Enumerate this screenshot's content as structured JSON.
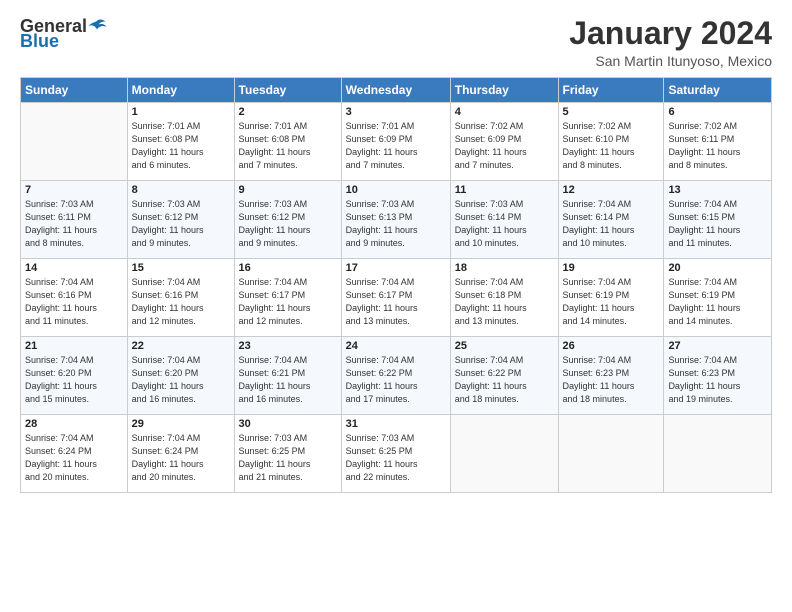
{
  "logo": {
    "general": "General",
    "blue": "Blue"
  },
  "title": "January 2024",
  "location": "San Martin Itunyoso, Mexico",
  "headers": [
    "Sunday",
    "Monday",
    "Tuesday",
    "Wednesday",
    "Thursday",
    "Friday",
    "Saturday"
  ],
  "weeks": [
    [
      {
        "num": "",
        "lines": []
      },
      {
        "num": "1",
        "lines": [
          "Sunrise: 7:01 AM",
          "Sunset: 6:08 PM",
          "Daylight: 11 hours",
          "and 6 minutes."
        ]
      },
      {
        "num": "2",
        "lines": [
          "Sunrise: 7:01 AM",
          "Sunset: 6:08 PM",
          "Daylight: 11 hours",
          "and 7 minutes."
        ]
      },
      {
        "num": "3",
        "lines": [
          "Sunrise: 7:01 AM",
          "Sunset: 6:09 PM",
          "Daylight: 11 hours",
          "and 7 minutes."
        ]
      },
      {
        "num": "4",
        "lines": [
          "Sunrise: 7:02 AM",
          "Sunset: 6:09 PM",
          "Daylight: 11 hours",
          "and 7 minutes."
        ]
      },
      {
        "num": "5",
        "lines": [
          "Sunrise: 7:02 AM",
          "Sunset: 6:10 PM",
          "Daylight: 11 hours",
          "and 8 minutes."
        ]
      },
      {
        "num": "6",
        "lines": [
          "Sunrise: 7:02 AM",
          "Sunset: 6:11 PM",
          "Daylight: 11 hours",
          "and 8 minutes."
        ]
      }
    ],
    [
      {
        "num": "7",
        "lines": [
          "Sunrise: 7:03 AM",
          "Sunset: 6:11 PM",
          "Daylight: 11 hours",
          "and 8 minutes."
        ]
      },
      {
        "num": "8",
        "lines": [
          "Sunrise: 7:03 AM",
          "Sunset: 6:12 PM",
          "Daylight: 11 hours",
          "and 9 minutes."
        ]
      },
      {
        "num": "9",
        "lines": [
          "Sunrise: 7:03 AM",
          "Sunset: 6:12 PM",
          "Daylight: 11 hours",
          "and 9 minutes."
        ]
      },
      {
        "num": "10",
        "lines": [
          "Sunrise: 7:03 AM",
          "Sunset: 6:13 PM",
          "Daylight: 11 hours",
          "and 9 minutes."
        ]
      },
      {
        "num": "11",
        "lines": [
          "Sunrise: 7:03 AM",
          "Sunset: 6:14 PM",
          "Daylight: 11 hours",
          "and 10 minutes."
        ]
      },
      {
        "num": "12",
        "lines": [
          "Sunrise: 7:04 AM",
          "Sunset: 6:14 PM",
          "Daylight: 11 hours",
          "and 10 minutes."
        ]
      },
      {
        "num": "13",
        "lines": [
          "Sunrise: 7:04 AM",
          "Sunset: 6:15 PM",
          "Daylight: 11 hours",
          "and 11 minutes."
        ]
      }
    ],
    [
      {
        "num": "14",
        "lines": [
          "Sunrise: 7:04 AM",
          "Sunset: 6:16 PM",
          "Daylight: 11 hours",
          "and 11 minutes."
        ]
      },
      {
        "num": "15",
        "lines": [
          "Sunrise: 7:04 AM",
          "Sunset: 6:16 PM",
          "Daylight: 11 hours",
          "and 12 minutes."
        ]
      },
      {
        "num": "16",
        "lines": [
          "Sunrise: 7:04 AM",
          "Sunset: 6:17 PM",
          "Daylight: 11 hours",
          "and 12 minutes."
        ]
      },
      {
        "num": "17",
        "lines": [
          "Sunrise: 7:04 AM",
          "Sunset: 6:17 PM",
          "Daylight: 11 hours",
          "and 13 minutes."
        ]
      },
      {
        "num": "18",
        "lines": [
          "Sunrise: 7:04 AM",
          "Sunset: 6:18 PM",
          "Daylight: 11 hours",
          "and 13 minutes."
        ]
      },
      {
        "num": "19",
        "lines": [
          "Sunrise: 7:04 AM",
          "Sunset: 6:19 PM",
          "Daylight: 11 hours",
          "and 14 minutes."
        ]
      },
      {
        "num": "20",
        "lines": [
          "Sunrise: 7:04 AM",
          "Sunset: 6:19 PM",
          "Daylight: 11 hours",
          "and 14 minutes."
        ]
      }
    ],
    [
      {
        "num": "21",
        "lines": [
          "Sunrise: 7:04 AM",
          "Sunset: 6:20 PM",
          "Daylight: 11 hours",
          "and 15 minutes."
        ]
      },
      {
        "num": "22",
        "lines": [
          "Sunrise: 7:04 AM",
          "Sunset: 6:20 PM",
          "Daylight: 11 hours",
          "and 16 minutes."
        ]
      },
      {
        "num": "23",
        "lines": [
          "Sunrise: 7:04 AM",
          "Sunset: 6:21 PM",
          "Daylight: 11 hours",
          "and 16 minutes."
        ]
      },
      {
        "num": "24",
        "lines": [
          "Sunrise: 7:04 AM",
          "Sunset: 6:22 PM",
          "Daylight: 11 hours",
          "and 17 minutes."
        ]
      },
      {
        "num": "25",
        "lines": [
          "Sunrise: 7:04 AM",
          "Sunset: 6:22 PM",
          "Daylight: 11 hours",
          "and 18 minutes."
        ]
      },
      {
        "num": "26",
        "lines": [
          "Sunrise: 7:04 AM",
          "Sunset: 6:23 PM",
          "Daylight: 11 hours",
          "and 18 minutes."
        ]
      },
      {
        "num": "27",
        "lines": [
          "Sunrise: 7:04 AM",
          "Sunset: 6:23 PM",
          "Daylight: 11 hours",
          "and 19 minutes."
        ]
      }
    ],
    [
      {
        "num": "28",
        "lines": [
          "Sunrise: 7:04 AM",
          "Sunset: 6:24 PM",
          "Daylight: 11 hours",
          "and 20 minutes."
        ]
      },
      {
        "num": "29",
        "lines": [
          "Sunrise: 7:04 AM",
          "Sunset: 6:24 PM",
          "Daylight: 11 hours",
          "and 20 minutes."
        ]
      },
      {
        "num": "30",
        "lines": [
          "Sunrise: 7:03 AM",
          "Sunset: 6:25 PM",
          "Daylight: 11 hours",
          "and 21 minutes."
        ]
      },
      {
        "num": "31",
        "lines": [
          "Sunrise: 7:03 AM",
          "Sunset: 6:25 PM",
          "Daylight: 11 hours",
          "and 22 minutes."
        ]
      },
      {
        "num": "",
        "lines": []
      },
      {
        "num": "",
        "lines": []
      },
      {
        "num": "",
        "lines": []
      }
    ]
  ]
}
